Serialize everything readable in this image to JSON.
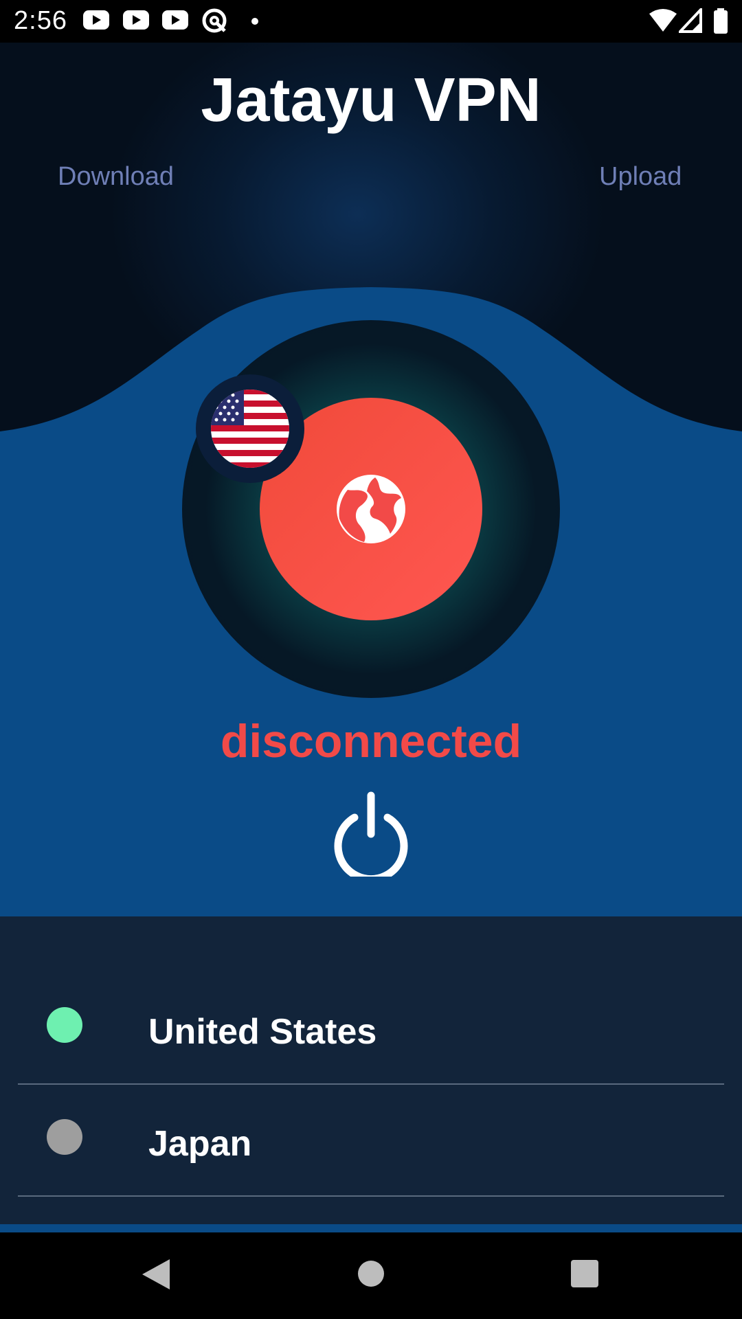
{
  "status_bar": {
    "time": "2:56",
    "notification_icons": [
      "youtube-icon",
      "youtube-icon",
      "youtube-icon",
      "at-icon",
      "dot-icon"
    ],
    "system_icons": [
      "wifi-icon",
      "signal-icon",
      "battery-icon"
    ]
  },
  "header": {
    "title": "Jatayu VPN",
    "download_label": "Download",
    "upload_label": "Upload"
  },
  "connection": {
    "selected_flag": "us-flag-icon",
    "center_icon": "globe-icon",
    "status": "disconnected",
    "power_icon": "power-icon"
  },
  "servers": [
    {
      "name": "United States",
      "status_color": "#6ef0b0",
      "selected": true
    },
    {
      "name": "Japan",
      "status_color": "#9e9e9e",
      "selected": false
    }
  ],
  "nav_bar": {
    "items": [
      "back-icon",
      "home-icon",
      "recents-icon"
    ]
  },
  "colors": {
    "background": "#050f1c",
    "body_blue": "#0a4b87",
    "accent_red": "#f24a48",
    "list_bg": "#12243a",
    "label": "#6f7fb6"
  }
}
